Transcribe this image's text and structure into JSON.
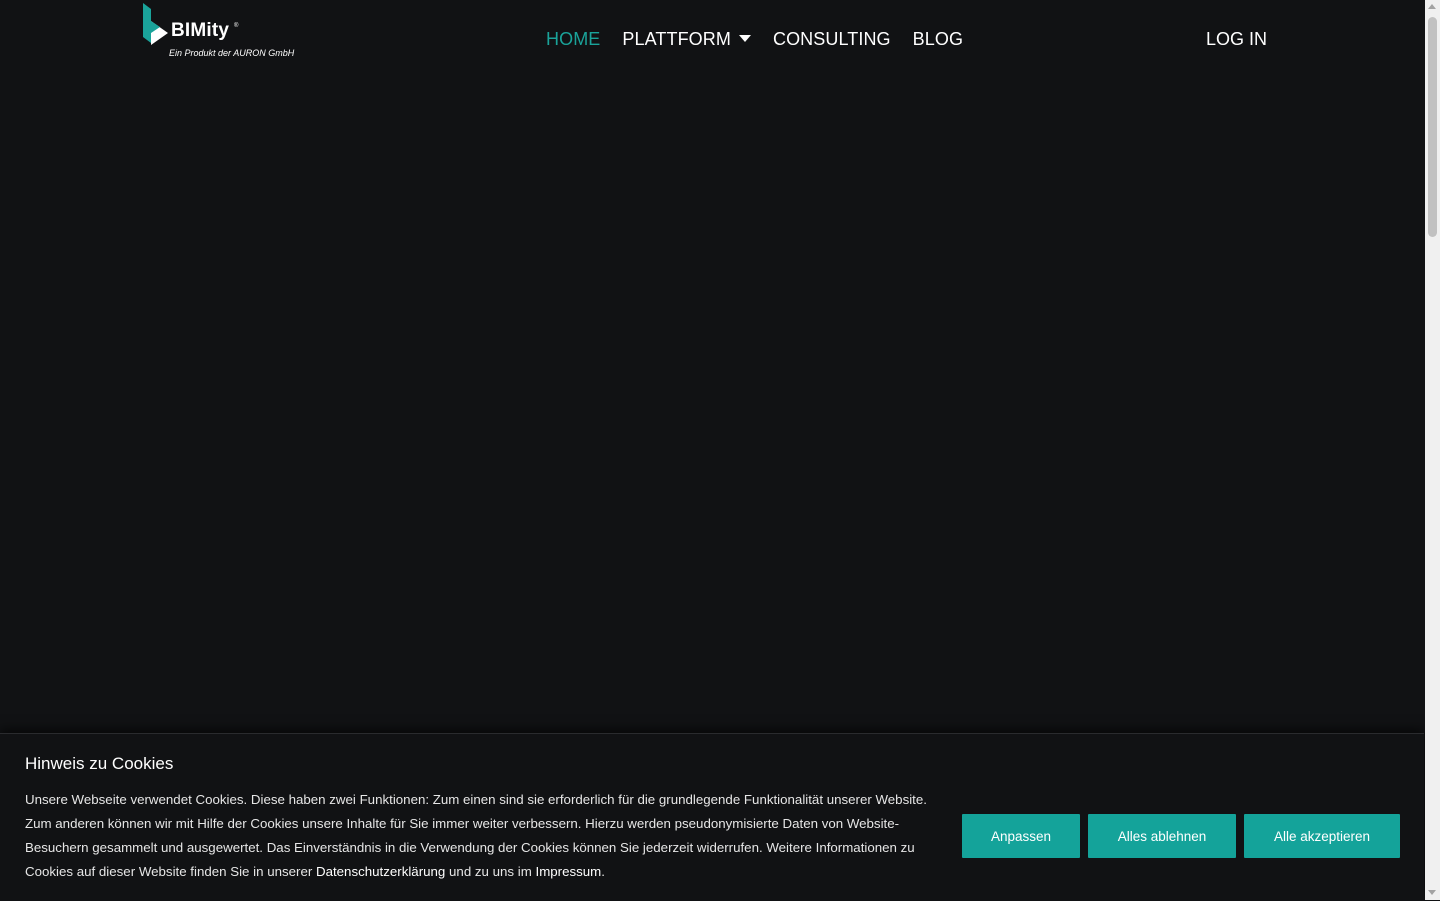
{
  "brand": {
    "name": "BIMity",
    "registered": "®",
    "tagline": "Ein Produkt der AURON GmbH",
    "accent_color": "#1aa39a"
  },
  "nav": {
    "items": [
      {
        "label": "HOME",
        "active": true
      },
      {
        "label": "PLATTFORM",
        "has_dropdown": true
      },
      {
        "label": "CONSULTING"
      },
      {
        "label": "BLOG"
      }
    ],
    "login_label": "LOG IN"
  },
  "cookie_banner": {
    "title": "Hinweis zu Cookies",
    "text_1": "Unsere Webseite verwendet Cookies. Diese haben zwei Funktionen: Zum einen sind sie erforderlich für die grundlegende Funktionalität unserer Website. Zum anderen können wir mit Hilfe der Cookies unsere Inhalte für Sie immer weiter verbessern. Hierzu werden pseudonymisierte Daten von Website-Besuchern gesammelt und ausgewertet. Das Einverständnis in die Verwendung der Cookies können Sie jederzeit widerrufen. Weitere Informationen zu Cookies auf dieser Website finden Sie in unserer ",
    "privacy_link": "Datenschutzerklärung",
    "text_2": " und zu uns im ",
    "imprint_link": "Impressum",
    "text_3": ".",
    "buttons": {
      "customize": "Anpassen",
      "reject_all": "Alles ablehnen",
      "accept_all": "Alle akzeptieren"
    },
    "button_color": "#14a39a"
  }
}
